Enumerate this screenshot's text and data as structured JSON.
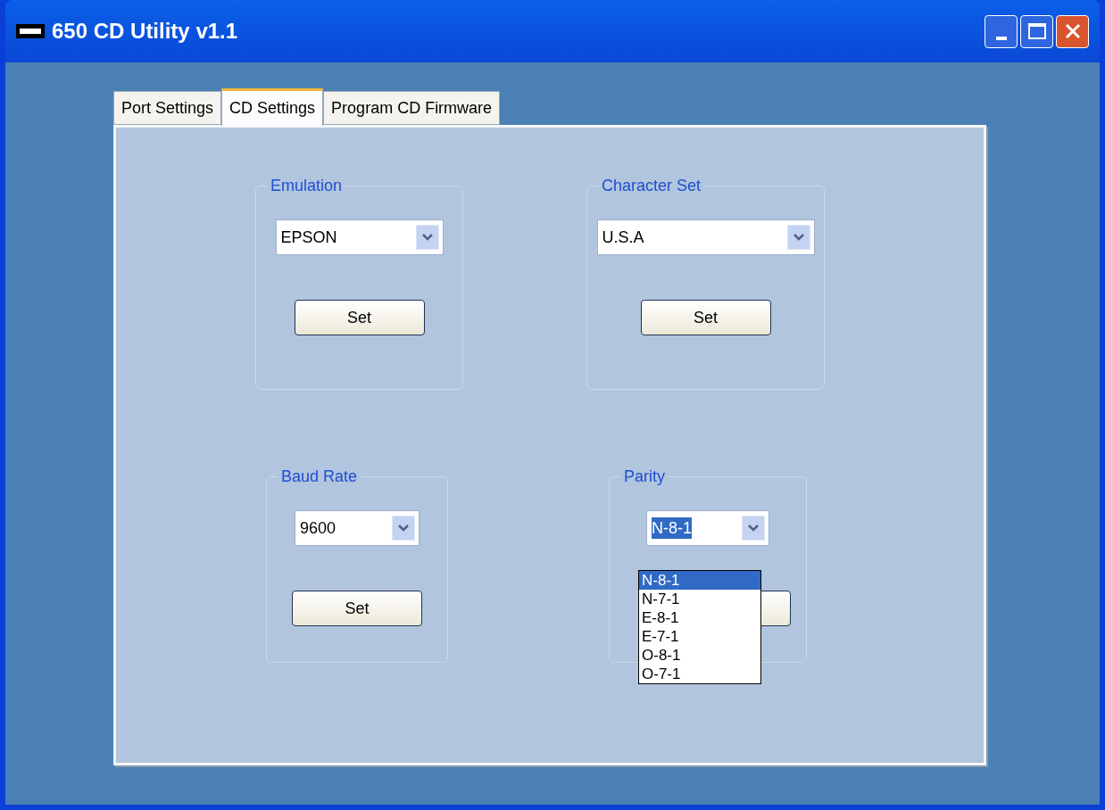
{
  "window": {
    "title": "650 CD Utility v1.1"
  },
  "tabs": [
    {
      "label": "Port Settings",
      "selected": false
    },
    {
      "label": "CD Settings",
      "selected": true
    },
    {
      "label": "Program CD Firmware",
      "selected": false
    }
  ],
  "groups": [
    {
      "title": "Emulation",
      "value": "EPSON",
      "value_highlighted": false,
      "button": "Set"
    },
    {
      "title": "Character Set",
      "value": "U.S.A",
      "value_highlighted": false,
      "button": "Set"
    },
    {
      "title": "Baud Rate",
      "value": "9600",
      "value_highlighted": false,
      "button": "Set"
    },
    {
      "title": "Parity",
      "value": "N-8-1",
      "value_highlighted": true,
      "button_hidden": true,
      "options": [
        {
          "label": "N-8-1",
          "selected": true
        },
        {
          "label": "N-7-1",
          "selected": false
        },
        {
          "label": "E-8-1",
          "selected": false
        },
        {
          "label": "E-7-1",
          "selected": false
        },
        {
          "label": "O-8-1",
          "selected": false
        },
        {
          "label": "O-7-1",
          "selected": false
        }
      ]
    }
  ]
}
